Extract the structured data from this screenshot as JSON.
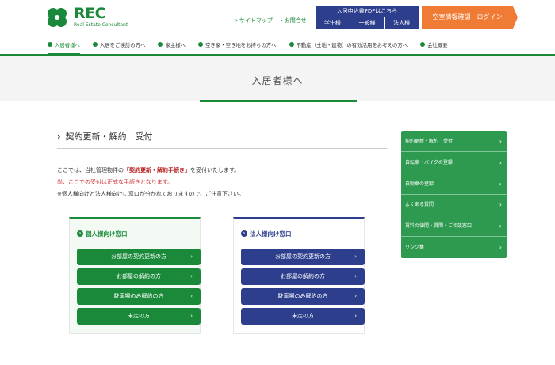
{
  "header": {
    "logo_text": "REC",
    "logo_sub": "Real Estate Consultant",
    "links": [
      {
        "label": "サイトマップ"
      },
      {
        "label": "お問合せ"
      }
    ],
    "pdf": {
      "title": "入居申込書PDFはこちら",
      "buttons": [
        "学生様",
        "一般様",
        "法人様"
      ]
    },
    "login_label": "空室情報確認　ログイン"
  },
  "nav": {
    "items": [
      {
        "label": "入居者様へ",
        "active": true
      },
      {
        "label": "入居をご検討の方へ"
      },
      {
        "label": "家主様へ"
      },
      {
        "label": "空き家・空き地をお持ちの方へ"
      },
      {
        "label": "不動産（土地・建物）の有効活用をお考えの方へ"
      },
      {
        "label": "会社概要"
      }
    ]
  },
  "hero": {
    "title": "入居者様へ"
  },
  "section": {
    "title": "契約更新・解約　受付",
    "intro_prefix": "ここでは、当社管理物件の",
    "intro_highlight": "「契約更新・解約手続き」",
    "intro_suffix": "を受付いたします。",
    "intro_line2": "尚、ここでの受付は正式な手続きとなります。",
    "intro_line3": "※個人様向けと法人様向けに窓口が分かれておりますので、ご注意下さい。"
  },
  "panels": {
    "personal": {
      "title": "個人様向け窓口",
      "buttons": [
        "お部屋の契約更新の方",
        "お部屋の解約の方",
        "駐車場のみ解約の方",
        "未定の方"
      ]
    },
    "corporate": {
      "title": "法人様向け窓口",
      "buttons": [
        "お部屋の契約更新の方",
        "お部屋の解約の方",
        "駐車場のみ解約の方",
        "未定の方"
      ]
    }
  },
  "side_menu": {
    "items": [
      "契約更新・解約　受付",
      "自転車・バイクの登録",
      "自動車の登録",
      "よくある質問",
      "賃料の値問・質問・ご相談窓口",
      "リンク集"
    ]
  },
  "colors": {
    "brand_green": "#1a8a3a",
    "navy": "#2d3f8c",
    "orange": "#f07b34",
    "side_green": "#2e9a50"
  }
}
